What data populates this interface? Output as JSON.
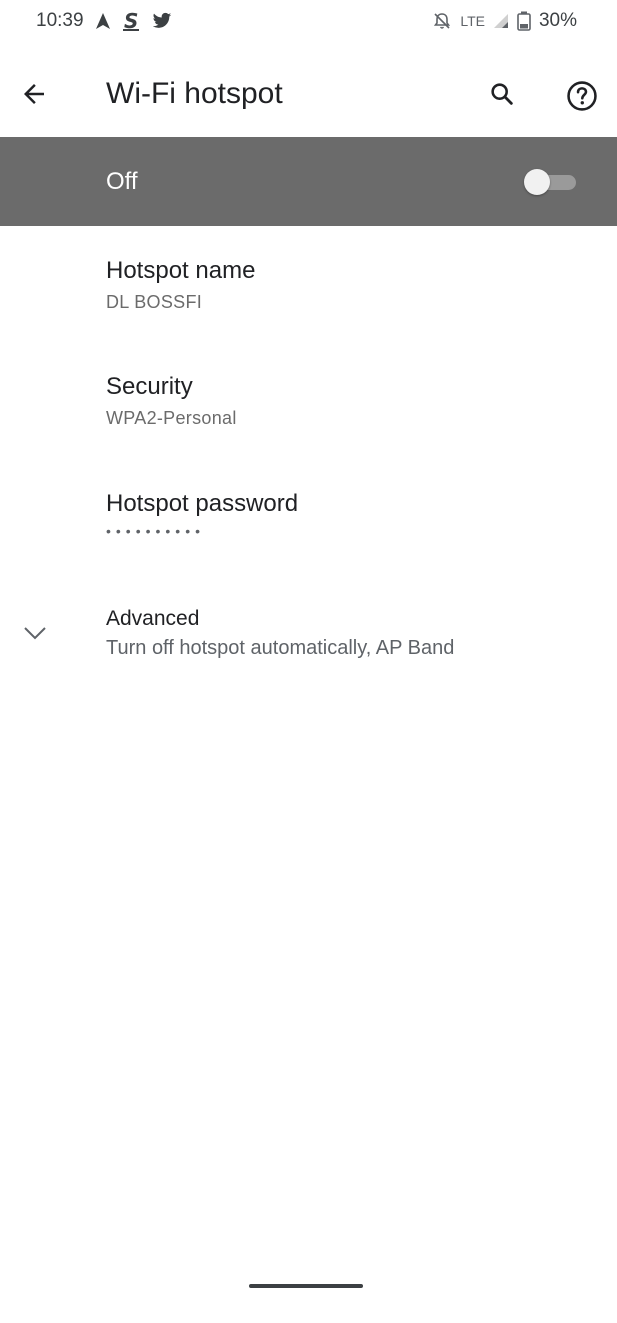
{
  "status_bar": {
    "time": "10:39",
    "network": "LTE",
    "battery": "30%",
    "left_icons": [
      "navigation-arrow-icon",
      "s-app-icon",
      "twitter-bird-icon"
    ],
    "right_icons": [
      "alarm-off-icon",
      "signal-icon",
      "battery-icon"
    ]
  },
  "app_bar": {
    "title": "Wi-Fi hotspot",
    "back_icon": "arrow-back-icon",
    "search_icon": "search-icon",
    "help_icon": "help-icon"
  },
  "master_switch": {
    "label": "Off",
    "enabled": false
  },
  "preferences": [
    {
      "title": "Hotspot name",
      "summary": "DL BOSSFI"
    },
    {
      "title": "Security",
      "summary": "WPA2-Personal"
    },
    {
      "title": "Hotspot password",
      "summary": "••••••••••"
    },
    {
      "title": "Advanced",
      "summary": "Turn off hotspot automatically, AP Band",
      "icon": "chevron-down-icon"
    }
  ],
  "colors": {
    "master_bar": "#6b6b6b",
    "text_primary": "#202124",
    "text_secondary": "#6b6b6b"
  }
}
